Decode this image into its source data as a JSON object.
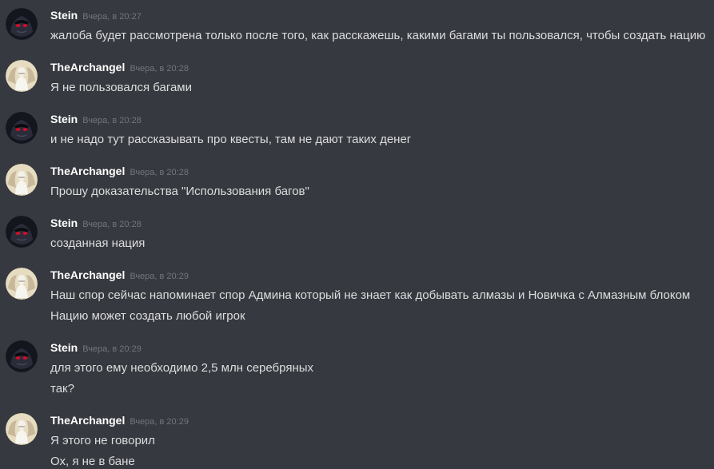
{
  "messages": [
    {
      "author": "Stein",
      "avatar_icon": "stein-avatar-icon",
      "timestamp": "Вчера, в 20:27",
      "lines": [
        "жалоба будет рассмотрена только после того, как расскажешь, какими багами ты пользовался, чтобы создать нацию"
      ]
    },
    {
      "author": "TheArchangel",
      "avatar_icon": "archangel-avatar-icon",
      "timestamp": "Вчера, в 20:28",
      "lines": [
        "Я не пользовался багами"
      ]
    },
    {
      "author": "Stein",
      "avatar_icon": "stein-avatar-icon",
      "timestamp": "Вчера, в 20:28",
      "lines": [
        "и не надо тут рассказывать про квесты, там не дают таких денег"
      ]
    },
    {
      "author": "TheArchangel",
      "avatar_icon": "archangel-avatar-icon",
      "timestamp": "Вчера, в 20:28",
      "lines": [
        "Прошу доказательства \"Использования багов\""
      ]
    },
    {
      "author": "Stein",
      "avatar_icon": "stein-avatar-icon",
      "timestamp": "Вчера, в 20:28",
      "lines": [
        "созданная нация"
      ]
    },
    {
      "author": "TheArchangel",
      "avatar_icon": "archangel-avatar-icon",
      "timestamp": "Вчера, в 20:29",
      "lines": [
        "Наш спор сейчас напоминает спор Админа который не знает как добывать алмазы и Новичка с Алмазным блоком",
        "Нацию может создать любой игрок"
      ]
    },
    {
      "author": "Stein",
      "avatar_icon": "stein-avatar-icon",
      "timestamp": "Вчера, в 20:29",
      "lines": [
        "для этого ему необходимо 2,5 млн серебряных",
        "так?"
      ]
    },
    {
      "author": "TheArchangel",
      "avatar_icon": "archangel-avatar-icon",
      "timestamp": "Вчера, в 20:29",
      "lines": [
        "Я этого не говорил",
        "Ох, я не в бане"
      ]
    }
  ],
  "colors": {
    "background": "#36393f",
    "author": "#ffffff",
    "message_text": "#dcddde",
    "timestamp": "#72767d"
  }
}
